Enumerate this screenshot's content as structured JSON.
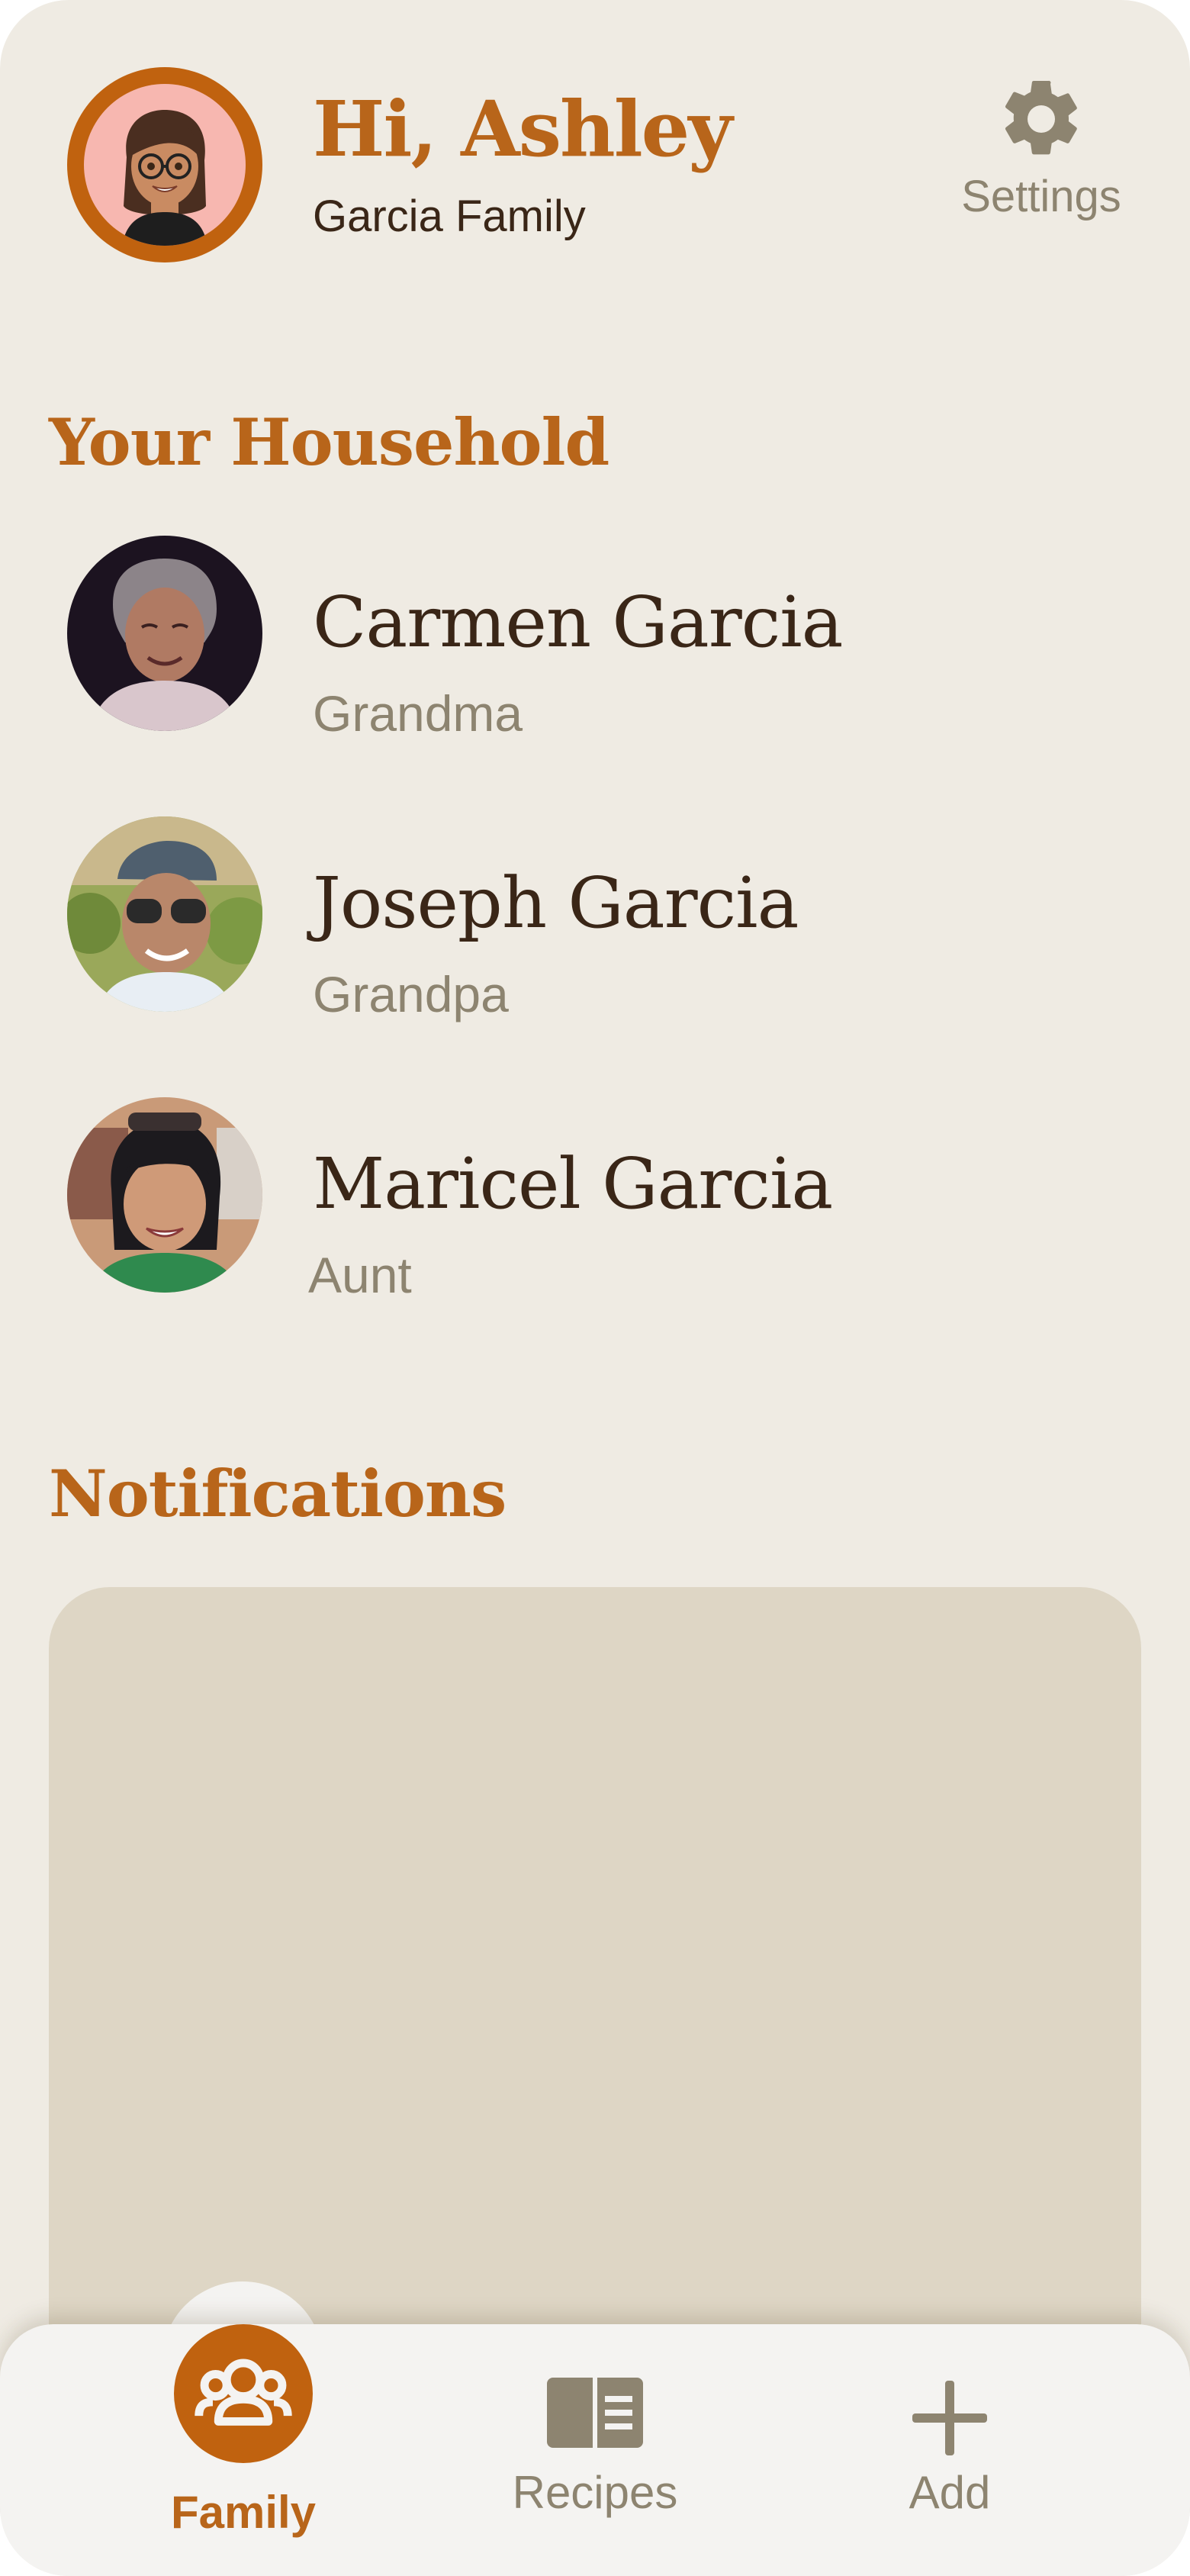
{
  "header": {
    "greeting": "Hi, Ashley",
    "family_name": "Garcia Family",
    "settings_label": "Settings"
  },
  "household": {
    "title": "Your Household",
    "members": [
      {
        "name": "Carmen Garcia",
        "relation": "Grandma"
      },
      {
        "name": "Joseph Garcia",
        "relation": "Grandpa"
      },
      {
        "name": "Maricel Garcia",
        "relation": "Aunt"
      }
    ]
  },
  "notifications": {
    "title": "Notifications"
  },
  "nav": {
    "family_label": "Family",
    "recipes_label": "Recipes",
    "add_label": "Add",
    "active_tab": "Family"
  },
  "colors": {
    "accent": "#b8651a",
    "background": "#efebe3",
    "text_dark": "#3a2617",
    "text_muted": "#8d8470",
    "card": "#ded6c5",
    "nav_bg": "#f4f3f1"
  }
}
